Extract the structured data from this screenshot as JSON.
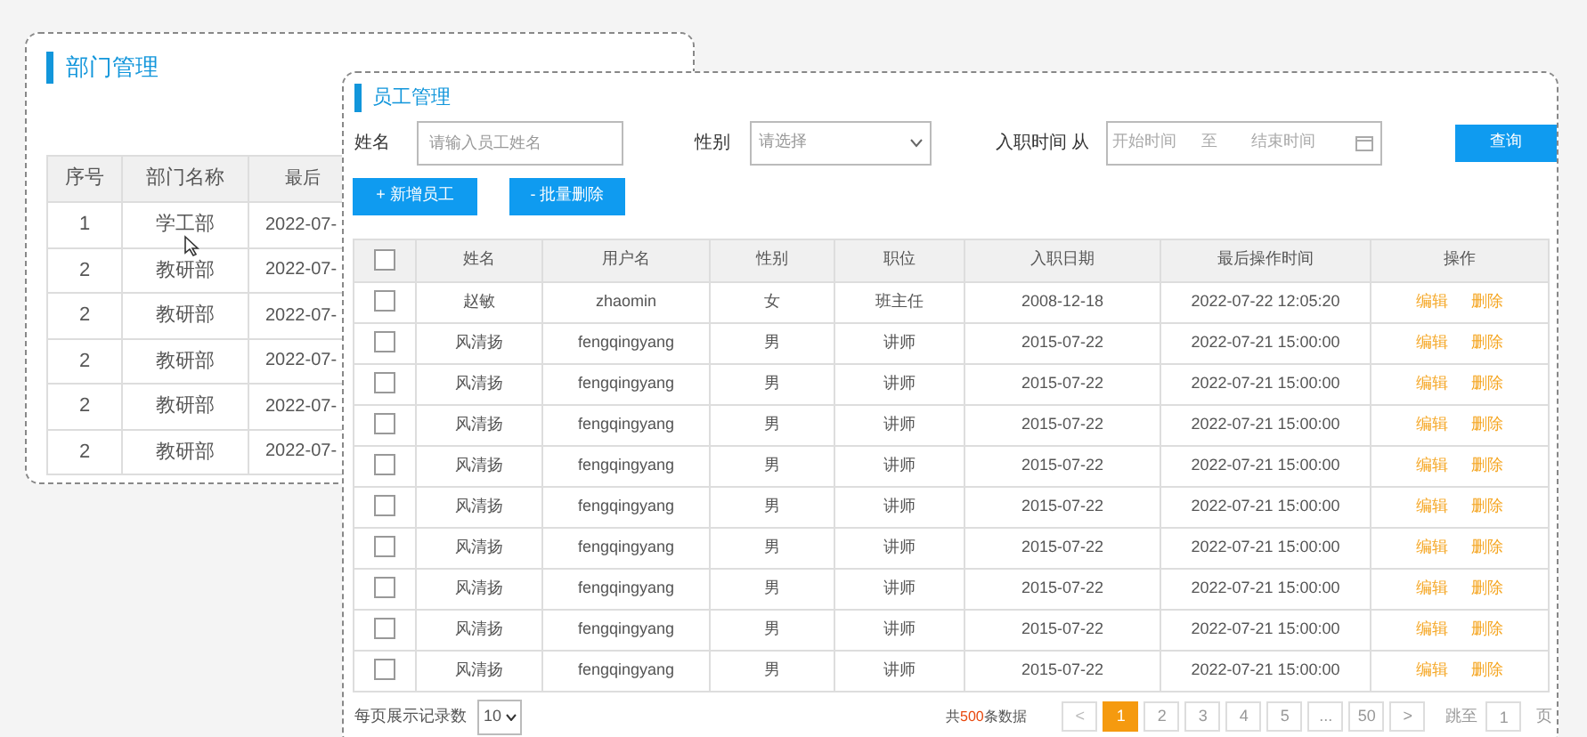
{
  "department_panel": {
    "title": "部门管理",
    "table": {
      "columns": [
        "序号",
        "部门名称",
        "最后"
      ],
      "rows": [
        [
          "1",
          "学工部",
          "2022-07-"
        ],
        [
          "2",
          "教研部",
          "2022-07-"
        ],
        [
          "2",
          "教研部",
          "2022-07-"
        ],
        [
          "2",
          "教研部",
          "2022-07-"
        ],
        [
          "2",
          "教研部",
          "2022-07-"
        ],
        [
          "2",
          "教研部",
          "2022-07-"
        ]
      ]
    }
  },
  "employee_panel": {
    "title": "员工管理",
    "filters": {
      "name_label": "姓名",
      "name_placeholder": "请输入员工姓名",
      "gender_label": "性别",
      "gender_placeholder": "请选择",
      "date_label": "入职时间 从",
      "start_placeholder": "开始时间",
      "separator": "至",
      "end_placeholder": "结束时间",
      "search_button": "查询"
    },
    "actions": [
      "+ 新增员工",
      "- 批量删除"
    ],
    "table": {
      "header_checked": false,
      "columns": [
        "姓名",
        "用户名",
        "性别",
        "职位",
        "入职日期",
        "最后操作时间",
        "操作"
      ],
      "rows": [
        {
          "checked": false,
          "cells": [
            "赵敏",
            "zhaomin",
            "女",
            "班主任",
            "2008-12-18",
            "2022-07-22 12:05:20"
          ],
          "edit": "编辑",
          "delete": "删除"
        },
        {
          "checked": false,
          "cells": [
            "风清扬",
            "fengqingyang",
            "男",
            "讲师",
            "2015-07-22",
            "2022-07-21 15:00:00"
          ],
          "edit": "编辑",
          "delete": "删除"
        },
        {
          "checked": false,
          "cells": [
            "风清扬",
            "fengqingyang",
            "男",
            "讲师",
            "2015-07-22",
            "2022-07-21 15:00:00"
          ],
          "edit": "编辑",
          "delete": "删除"
        },
        {
          "checked": false,
          "cells": [
            "风清扬",
            "fengqingyang",
            "男",
            "讲师",
            "2015-07-22",
            "2022-07-21 15:00:00"
          ],
          "edit": "编辑",
          "delete": "删除"
        },
        {
          "checked": false,
          "cells": [
            "风清扬",
            "fengqingyang",
            "男",
            "讲师",
            "2015-07-22",
            "2022-07-21 15:00:00"
          ],
          "edit": "编辑",
          "delete": "删除"
        },
        {
          "checked": false,
          "cells": [
            "风清扬",
            "fengqingyang",
            "男",
            "讲师",
            "2015-07-22",
            "2022-07-21 15:00:00"
          ],
          "edit": "编辑",
          "delete": "删除"
        },
        {
          "checked": false,
          "cells": [
            "风清扬",
            "fengqingyang",
            "男",
            "讲师",
            "2015-07-22",
            "2022-07-21 15:00:00"
          ],
          "edit": "编辑",
          "delete": "删除"
        },
        {
          "checked": false,
          "cells": [
            "风清扬",
            "fengqingyang",
            "男",
            "讲师",
            "2015-07-22",
            "2022-07-21 15:00:00"
          ],
          "edit": "编辑",
          "delete": "删除"
        },
        {
          "checked": false,
          "cells": [
            "风清扬",
            "fengqingyang",
            "男",
            "讲师",
            "2015-07-22",
            "2022-07-21 15:00:00"
          ],
          "edit": "编辑",
          "delete": "删除"
        },
        {
          "checked": false,
          "cells": [
            "风清扬",
            "fengqingyang",
            "男",
            "讲师",
            "2015-07-22",
            "2022-07-21 15:00:00"
          ],
          "edit": "编辑",
          "delete": "删除"
        }
      ]
    },
    "footer": {
      "page_size_label": "每页展示记录数",
      "page_size": "10",
      "total": "共**500**条数据",
      "prev": "<",
      "pages": [
        {
          "label": "1",
          "selected": true
        },
        {
          "label": "2",
          "selected": false
        },
        {
          "label": "3",
          "selected": false
        },
        {
          "label": "4",
          "selected": false
        },
        {
          "label": "5",
          "selected": false
        },
        {
          "label": "...",
          "selected": false
        },
        {
          "label": "50",
          "selected": false
        }
      ],
      "next": ">",
      "goto_label": "跳至",
      "goto_value": "1",
      "page_suffix": "页"
    }
  }
}
